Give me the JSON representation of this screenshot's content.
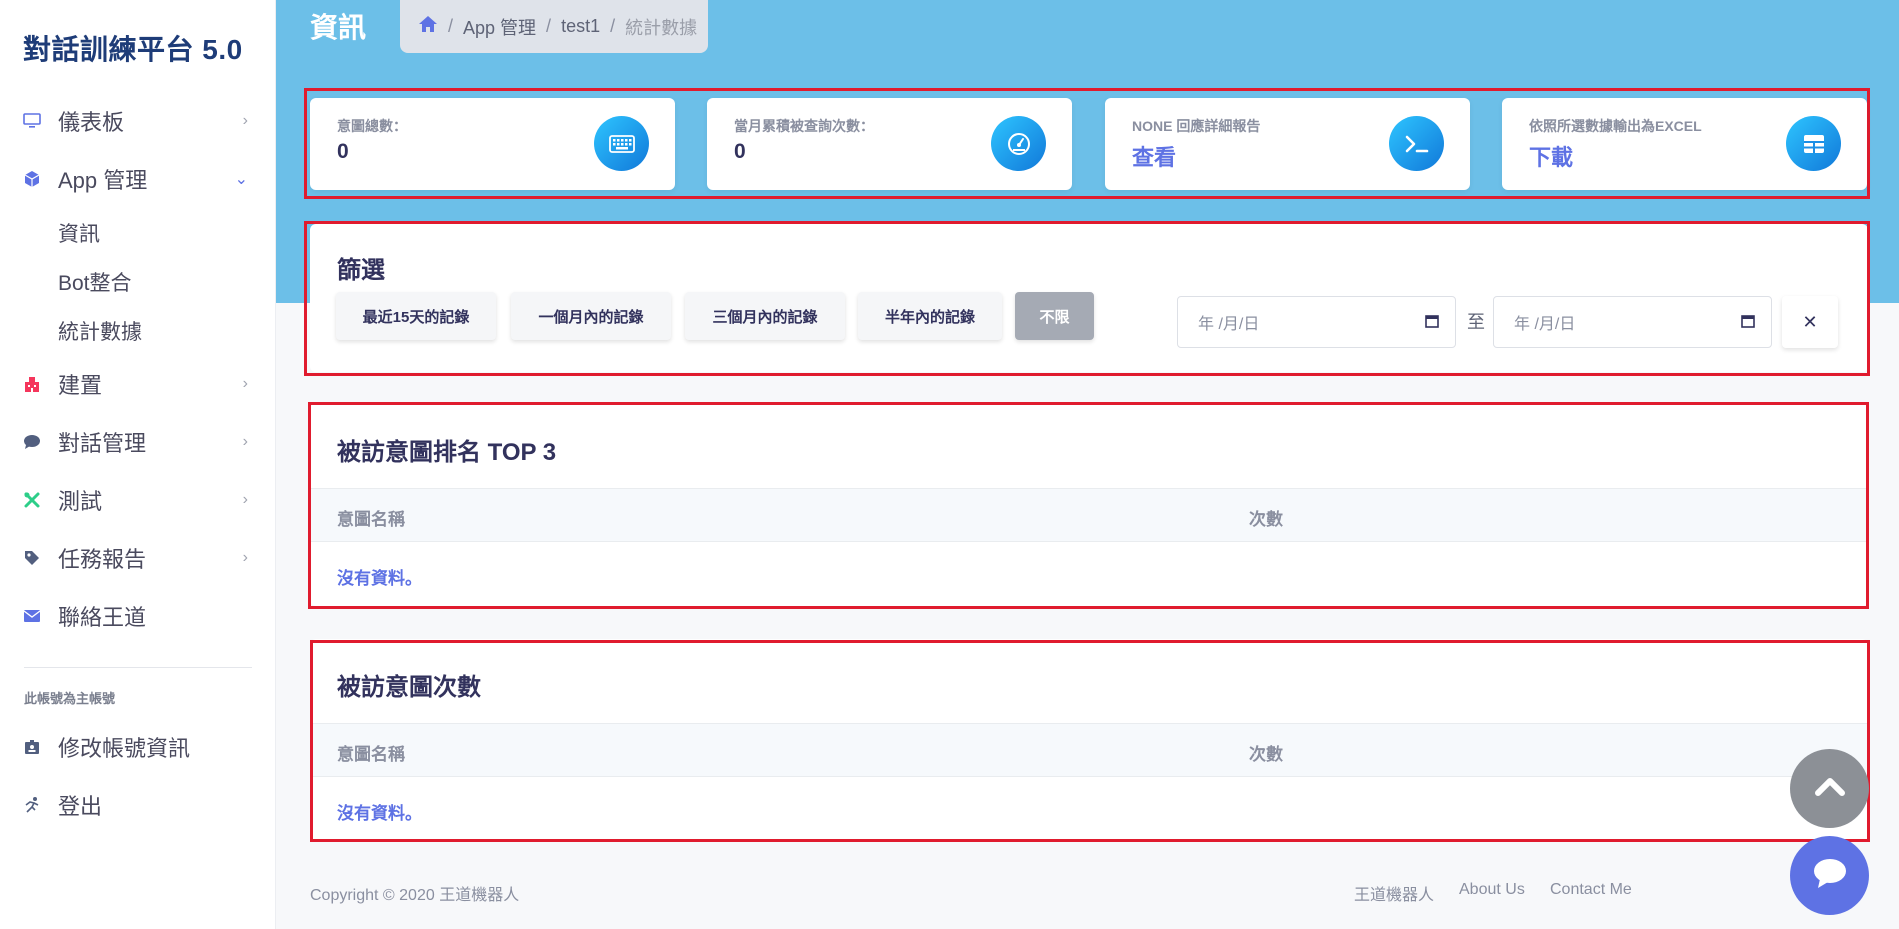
{
  "sidebar": {
    "brand": "對話訓練平台 5.0",
    "items": [
      {
        "label": "儀表板",
        "icon": "monitor-icon"
      },
      {
        "label": "App 管理",
        "icon": "cube-icon"
      },
      {
        "label": "建置",
        "icon": "building-icon"
      },
      {
        "label": "對話管理",
        "icon": "chat-bubble-icon"
      },
      {
        "label": "測試",
        "icon": "tools-icon"
      },
      {
        "label": "任務報告",
        "icon": "tag-icon"
      },
      {
        "label": "聯絡王道",
        "icon": "envelope-icon"
      }
    ],
    "subitems": [
      "資訊",
      "Bot整合",
      "統計數據"
    ],
    "account_heading": "此帳號為主帳號",
    "account_items": [
      {
        "label": "修改帳號資訊",
        "icon": "id-card-icon"
      },
      {
        "label": "登出",
        "icon": "running-icon"
      }
    ]
  },
  "header": {
    "title": "資訊",
    "breadcrumb": [
      "App 管理",
      "test1",
      "統計數據"
    ]
  },
  "stats": [
    {
      "label": "意圖總數：",
      "value": "0",
      "icon": "keyboard-icon"
    },
    {
      "label": "當月累積被查詢次數：",
      "value": "0",
      "icon": "speedometer-icon"
    },
    {
      "label": "NONE 回應詳細報告",
      "value": "查看",
      "icon": "terminal-icon"
    },
    {
      "label": "依照所選數據輸出為EXCEL",
      "value": "下載",
      "icon": "grid-icon"
    }
  ],
  "filter": {
    "title": "篩選",
    "buttons": [
      "最近15天的記錄",
      "一個月內的記錄",
      "三個月內的記錄",
      "半年內的記錄",
      "不限"
    ],
    "date_placeholder": "年 /月/日",
    "to_label": "至",
    "clear_label": "✕"
  },
  "tables": [
    {
      "title": "被訪意圖排名 TOP 3",
      "col1": "意圖名稱",
      "col2": "次數",
      "empty": "沒有資料。"
    },
    {
      "title": "被訪意圖次數",
      "col1": "意圖名稱",
      "col2": "次數",
      "empty": "沒有資料。"
    }
  ],
  "footer": {
    "copyright": "Copyright © 2020 王道機器人",
    "links": [
      "王道機器人",
      "About Us",
      "Contact Me"
    ]
  },
  "colors": {
    "accent": "#5e72e4",
    "hero": "#6cbfe8",
    "highlight": "#e01b2e"
  }
}
